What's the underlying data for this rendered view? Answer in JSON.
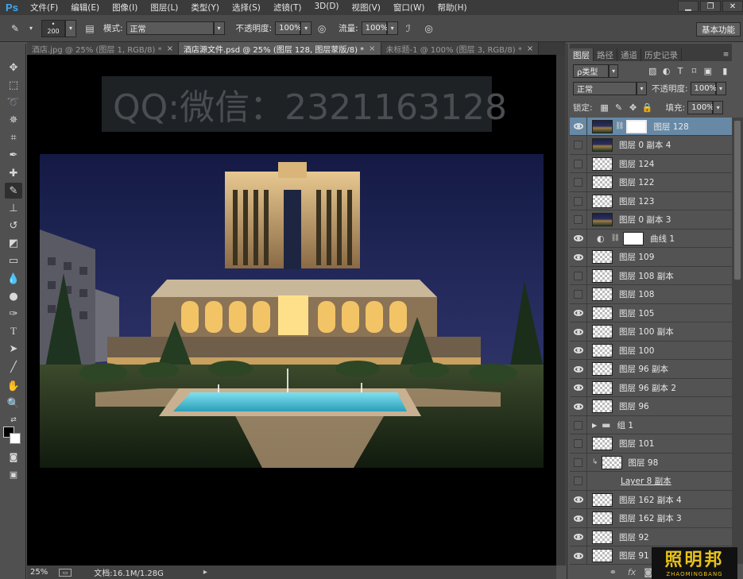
{
  "app": {
    "logo": "Ps"
  },
  "menu": [
    "文件(F)",
    "编辑(E)",
    "图像(I)",
    "图层(L)",
    "类型(Y)",
    "选择(S)",
    "滤镜(T)",
    "3D(D)",
    "视图(V)",
    "窗口(W)",
    "帮助(H)"
  ],
  "window_controls": [
    "minimize-icon",
    "restore-icon",
    "close-icon"
  ],
  "options": {
    "brush_size": "200",
    "mode_label": "模式:",
    "mode_value": "正常",
    "opacity_label": "不透明度:",
    "opacity_value": "100%",
    "flow_label": "流量:",
    "flow_value": "100%",
    "workspace": "基本功能"
  },
  "doc_tabs": [
    {
      "label": "酒店.jpg @ 25% (图层 1, RGB/8) *",
      "active": false
    },
    {
      "label": "酒店源文件.psd @ 25% (图层 128, 图层蒙版/8) *",
      "active": true
    },
    {
      "label": "未标题-1 @ 100% (图层 3, RGB/8) *",
      "active": false
    }
  ],
  "watermark": "QQ:微信：2321163128",
  "status": {
    "zoom": "25%",
    "doc": "文档:16.1M/1.28G"
  },
  "panel": {
    "tabs": [
      "图层",
      "路径",
      "通道",
      "历史记录"
    ],
    "kind_label": "ρ类型",
    "blend_mode": "正常",
    "opacity_label": "不透明度:",
    "opacity_value": "100%",
    "lock_label": "锁定:",
    "fill_label": "填充:",
    "fill_value": "100%"
  },
  "layers": [
    {
      "name": "图层 128",
      "visible": true,
      "thumb": "photo",
      "mask": true,
      "selected": true
    },
    {
      "name": "图层 0 副本 4",
      "visible": false,
      "thumb": "photo"
    },
    {
      "name": "图层 124",
      "visible": false,
      "thumb": "trans"
    },
    {
      "name": "图层 122",
      "visible": false,
      "thumb": "trans"
    },
    {
      "name": "图层 123",
      "visible": false,
      "thumb": "trans"
    },
    {
      "name": "图层 0 副本 3",
      "visible": false,
      "thumb": "photo"
    },
    {
      "name": "曲线 1",
      "visible": true,
      "thumb": "white",
      "adjust": true
    },
    {
      "name": "图层 109",
      "visible": true,
      "thumb": "trans"
    },
    {
      "name": "图层 108 副本",
      "visible": false,
      "thumb": "trans"
    },
    {
      "name": "图层 108",
      "visible": false,
      "thumb": "trans"
    },
    {
      "name": "图层 105",
      "visible": true,
      "thumb": "trans"
    },
    {
      "name": "图层 100 副本",
      "visible": true,
      "thumb": "trans"
    },
    {
      "name": "图层 100",
      "visible": true,
      "thumb": "trans"
    },
    {
      "name": "图层 96 副本",
      "visible": true,
      "thumb": "trans"
    },
    {
      "name": "图层 96 副本 2",
      "visible": true,
      "thumb": "trans"
    },
    {
      "name": "图层 96",
      "visible": true,
      "thumb": "trans"
    },
    {
      "name": "组 1",
      "visible": false,
      "thumb": "folder"
    },
    {
      "name": "图层 101",
      "visible": false,
      "thumb": "trans"
    },
    {
      "name": "图层 98",
      "visible": false,
      "thumb": "trans",
      "clip": true
    },
    {
      "name": "Layer 8 副本",
      "visible": false,
      "thumb": "none",
      "link": true
    },
    {
      "name": "图层 162 副本 4",
      "visible": true,
      "thumb": "trans"
    },
    {
      "name": "图层 162 副本 3",
      "visible": true,
      "thumb": "trans"
    },
    {
      "name": "图层 92",
      "visible": true,
      "thumb": "trans"
    },
    {
      "name": "图层 91",
      "visible": true,
      "thumb": "trans"
    }
  ],
  "bottom_icons": [
    "link-icon",
    "fx-icon",
    "mask-icon"
  ],
  "brand": {
    "text": "照明邦",
    "sub": "ZHAOMINGBANG"
  },
  "colors": {
    "accent": "#6789a6",
    "brand_yellow": "#e8c21a",
    "ps_blue": "#3fa9f5"
  }
}
